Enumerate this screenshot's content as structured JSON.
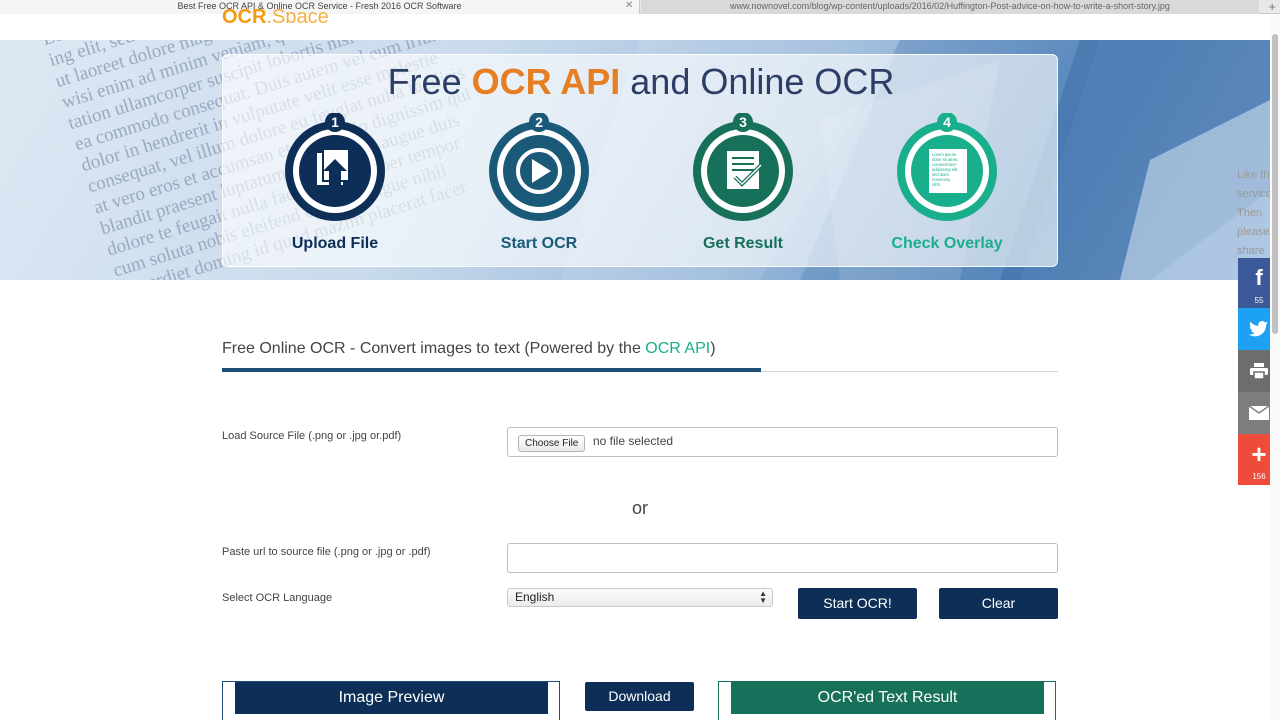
{
  "browser": {
    "active_tab": "Best Free OCR API & Online OCR Service - Fresh 2016 OCR Software",
    "inactive_tab": "www.nownovel.com/blog/wp-content/uploads/2016/02/Huffington-Post-advice-on-how-to-write-a-short-story.jpg",
    "close_glyph": "✕",
    "new_tab_glyph": "+"
  },
  "logo": {
    "part1": "OCR",
    "part2": ".Space"
  },
  "hero": {
    "title_prefix": "Free ",
    "title_accent": "OCR API",
    "title_suffix": " and Online OCR",
    "background_text": [
      "Lorem ipsum dolor sit amet, consectetuer adipiscing",
      "ing elit, sed diam nonummy nibh euismod tincidunt",
      "ut laoreet dolore magna aliquam erat volutpat.",
      "wisi enim ad minim veniam, quis nostrud exerci",
      "tation ullamcorper suscipit lobortis nisl ut aliquip ex",
      "ea commodo consequat. Duis autem vel eum iriure",
      "dolor in hendrerit in vulputate velit esse molestie",
      "consequat, vel illum dolore eu feugiat nulla facilisis",
      "at vero eros et accumsan et iusto odio dignissim qui",
      "blandit praesent luptatum zzril delenit augue duis",
      "dolore te feugait nulla facilisi. Nam liber tempor",
      "cum soluta nobis eleifend option congue nihil",
      "imperdiet doming id quod mazim placerat facer"
    ],
    "steps": [
      {
        "number": "1",
        "label": "Upload File",
        "color": "#0d2f57"
      },
      {
        "number": "2",
        "label": "Start OCR",
        "color": "#1a5a78"
      },
      {
        "number": "3",
        "label": "Get Result",
        "color": "#17705a"
      },
      {
        "number": "4",
        "label": "Check Overlay",
        "color": "#1aaf8c"
      }
    ],
    "overlay_doc_text": "Lorem ipsum dolor sit amet, consectetuer adipiscing elit, sed diam nonummy nibh"
  },
  "share": {
    "note": [
      "Like the",
      "service?",
      "Then",
      "please",
      "share"
    ],
    "buttons": [
      {
        "icon": "facebook-icon",
        "glyph": "f",
        "count": "55",
        "color": "#3b5998"
      },
      {
        "icon": "twitter-icon",
        "glyph": "",
        "count": "",
        "color": "#1da1f2"
      },
      {
        "icon": "print-icon",
        "glyph": "",
        "count": "",
        "color": "#6d6d6d"
      },
      {
        "icon": "email-icon",
        "glyph": "",
        "count": "",
        "color": "#7d7d7d"
      },
      {
        "icon": "plus-icon",
        "glyph": "+",
        "count": "156",
        "color": "#ee4b3a"
      }
    ]
  },
  "section": {
    "title_prefix": "Free Online OCR - Convert images to text (Powered by the ",
    "title_link": "OCR API",
    "title_suffix": ")"
  },
  "form": {
    "file_label": "Load Source File (.png or .jpg or.pdf)",
    "choose_file": "Choose File",
    "file_status": "no file selected",
    "or_text": "or",
    "url_label": "Paste url to source file (.png or .jpg or .pdf)",
    "url_value": "",
    "language_label": "Select OCR Language",
    "language_selected": "English",
    "start_button": "Start OCR!",
    "clear_button": "Clear"
  },
  "results": {
    "image_preview": "Image Preview",
    "download": "Download",
    "text_result": "OCR'ed Text Result"
  },
  "colors": {
    "navy": "#0d2f57",
    "accent_orange": "#e67e22",
    "teal": "#1aaf8c",
    "result_green": "#17705a"
  }
}
